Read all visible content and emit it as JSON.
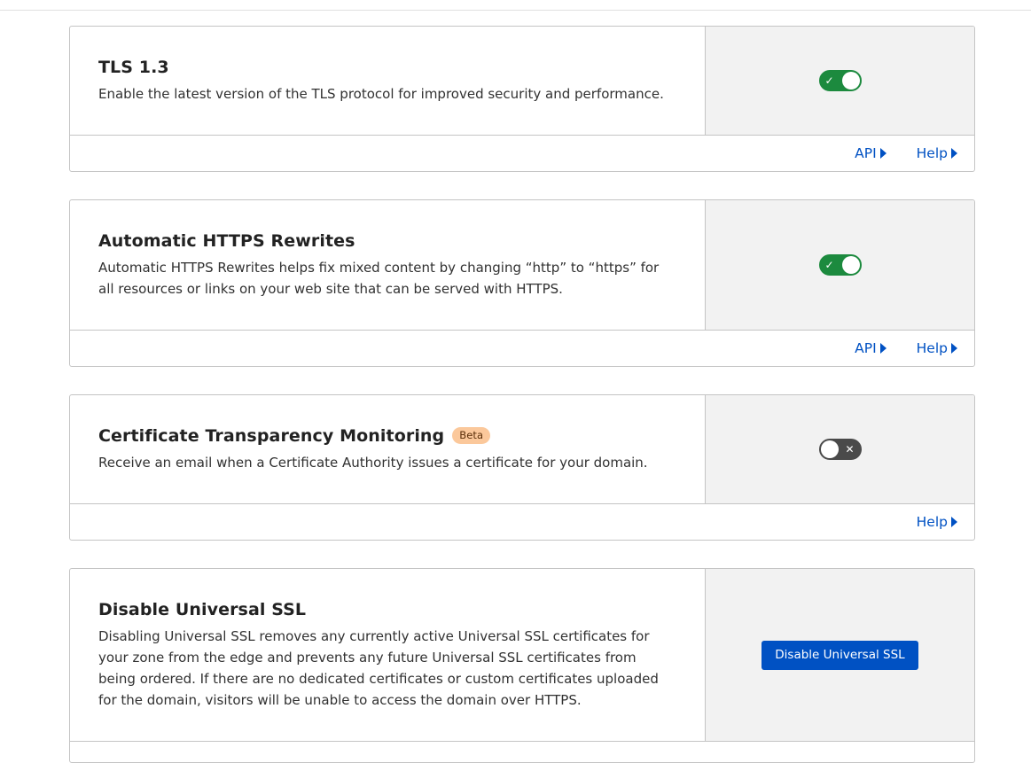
{
  "cards": [
    {
      "title": "TLS 1.3",
      "description": "Enable the latest version of the TLS protocol for improved security and performance.",
      "toggle_state": "on",
      "toggle_icon": "check-icon",
      "footer_links": {
        "api": "API",
        "help": "Help"
      }
    },
    {
      "title": "Automatic HTTPS Rewrites",
      "description": "Automatic HTTPS Rewrites helps fix mixed content by changing “http” to “https” for all resources or links on your web site that can be served with HTTPS.",
      "toggle_state": "on",
      "toggle_icon": "check-icon",
      "footer_links": {
        "api": "API",
        "help": "Help"
      }
    },
    {
      "title": "Certificate Transparency Monitoring",
      "badge": "Beta",
      "description": "Receive an email when a Certificate Authority issues a certificate for your domain.",
      "toggle_state": "off",
      "toggle_icon": "x-icon",
      "footer_links": {
        "help": "Help"
      }
    },
    {
      "title": "Disable Universal SSL",
      "description": "Disabling Universal SSL removes any currently active Universal SSL certificates for your zone from the edge and prevents any future Universal SSL certificates from being ordered. If there are no dedicated certificates or custom certificates uploaded for the domain, visitors will be unable to access the domain over HTTPS.",
      "button_label": "Disable Universal SSL"
    }
  ],
  "colors": {
    "toggle_on": "#1c8a3e",
    "toggle_off": "#4a4a4a",
    "link": "#0051c3",
    "primary_button": "#0051c3",
    "badge_bg": "#fbc89b",
    "control_panel_bg": "#f2f2f2"
  }
}
